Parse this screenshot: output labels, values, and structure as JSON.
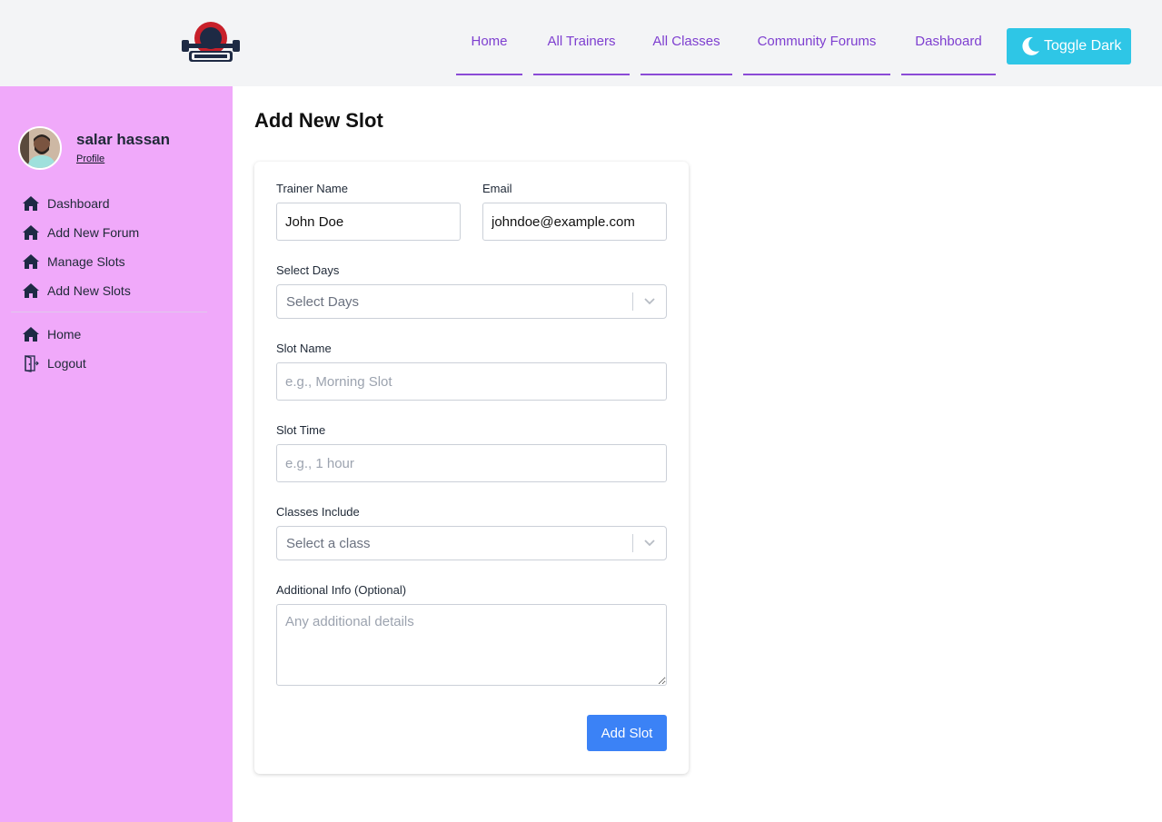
{
  "header": {
    "logo_alt": "FITNESS",
    "nav": [
      {
        "label": "Home"
      },
      {
        "label": "All Trainers"
      },
      {
        "label": "All Classes"
      },
      {
        "label": "Community Forums"
      },
      {
        "label": "Dashboard"
      }
    ],
    "toggle_label": "Toggle Dark"
  },
  "sidebar": {
    "user_name": "salar hassan",
    "profile_link": "Profile",
    "items": [
      {
        "label": "Dashboard"
      },
      {
        "label": "Add New Forum"
      },
      {
        "label": "Manage Slots"
      },
      {
        "label": "Add New Slots"
      }
    ],
    "bottom_items": [
      {
        "label": "Home"
      },
      {
        "label": "Logout"
      }
    ]
  },
  "main": {
    "title": "Add New Slot",
    "form": {
      "trainer_name_label": "Trainer Name",
      "trainer_name_value": "John Doe",
      "email_label": "Email",
      "email_value": "johndoe@example.com",
      "days_label": "Select Days",
      "days_placeholder": "Select Days",
      "slot_name_label": "Slot Name",
      "slot_name_placeholder": "e.g., Morning Slot",
      "slot_time_label": "Slot Time",
      "slot_time_placeholder": "e.g., 1 hour",
      "classes_label": "Classes Include",
      "classes_placeholder": "Select a class",
      "info_label": "Additional Info (Optional)",
      "info_placeholder": "Any additional details",
      "submit_label": "Add Slot"
    }
  },
  "colors": {
    "sidebar_bg": "#f0a9fa",
    "nav_link": "#7e3fd0",
    "toggle_bg": "#2ec6e6",
    "submit_bg": "#3b82f6"
  }
}
